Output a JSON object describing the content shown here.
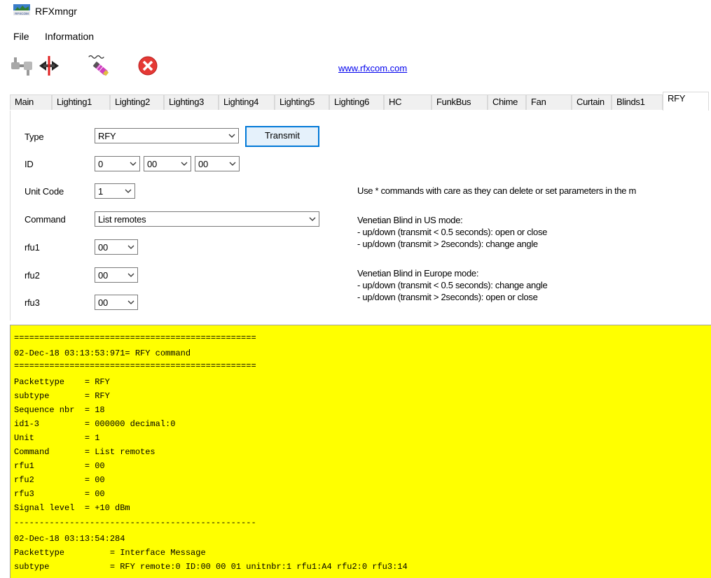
{
  "window": {
    "title": "RFXmngr"
  },
  "menu": {
    "items": [
      "File",
      "Information"
    ]
  },
  "toolbar": {
    "buttons": [
      "connect-icon",
      "disconnect-icon",
      "sniffer-icon",
      "stop-icon"
    ],
    "link": "www.rfxcom.com"
  },
  "tabs": [
    "Main",
    "Lighting1",
    "Lighting2",
    "Lighting3",
    "Lighting4",
    "Lighting5",
    "Lighting6",
    "HC",
    "FunkBus",
    "Chime",
    "Fan",
    "Curtain",
    "Blinds1",
    "RFY"
  ],
  "active_tab": "RFY",
  "form": {
    "type_label": "Type",
    "type_value": "RFY",
    "transmit_label": "Transmit",
    "id_label": "ID",
    "id_values": [
      "0",
      "00",
      "00"
    ],
    "unit_label": "Unit Code",
    "unit_value": "1",
    "command_label": "Command",
    "command_value": "List remotes",
    "rfu1_label": "rfu1",
    "rfu1_value": "00",
    "rfu2_label": "rfu2",
    "rfu2_value": "00",
    "rfu3_label": "rfu3",
    "rfu3_value": "00"
  },
  "info": {
    "caution": "Use * commands with care as they can delete or set parameters in the m",
    "us_title": "Venetian Blind in US mode:",
    "us_line1": "- up/down (transmit < 0.5 seconds): open or close",
    "us_line2": "- up/down (transmit > 2seconds): change angle",
    "eu_title": "Venetian Blind in Europe mode:",
    "eu_line1": "- up/down (transmit < 0.5 seconds): change angle",
    "eu_line2": "- up/down (transmit > 2seconds): open or close"
  },
  "log": {
    "lines": [
      "================================================",
      "02-Dec-18 03:13:53:971= RFY command",
      "================================================",
      "Packettype    = RFY",
      "subtype       = RFY",
      "Sequence nbr  = 18",
      "id1-3         = 000000 decimal:0",
      "Unit          = 1",
      "Command       = List remotes",
      "rfu1          = 00",
      "rfu2          = 00",
      "rfu3          = 00",
      "Signal level  = +10 dBm",
      "------------------------------------------------",
      "02-Dec-18 03:13:54:284",
      "Packettype         = Interface Message",
      "subtype            = RFY remote:0 ID:00 00 01 unitnbr:1 rfu1:A4 rfu2:0 rfu3:14"
    ]
  },
  "colors": {
    "log_background": "#ffff00",
    "link": "#0000ee",
    "button_border": "#0078d7"
  }
}
